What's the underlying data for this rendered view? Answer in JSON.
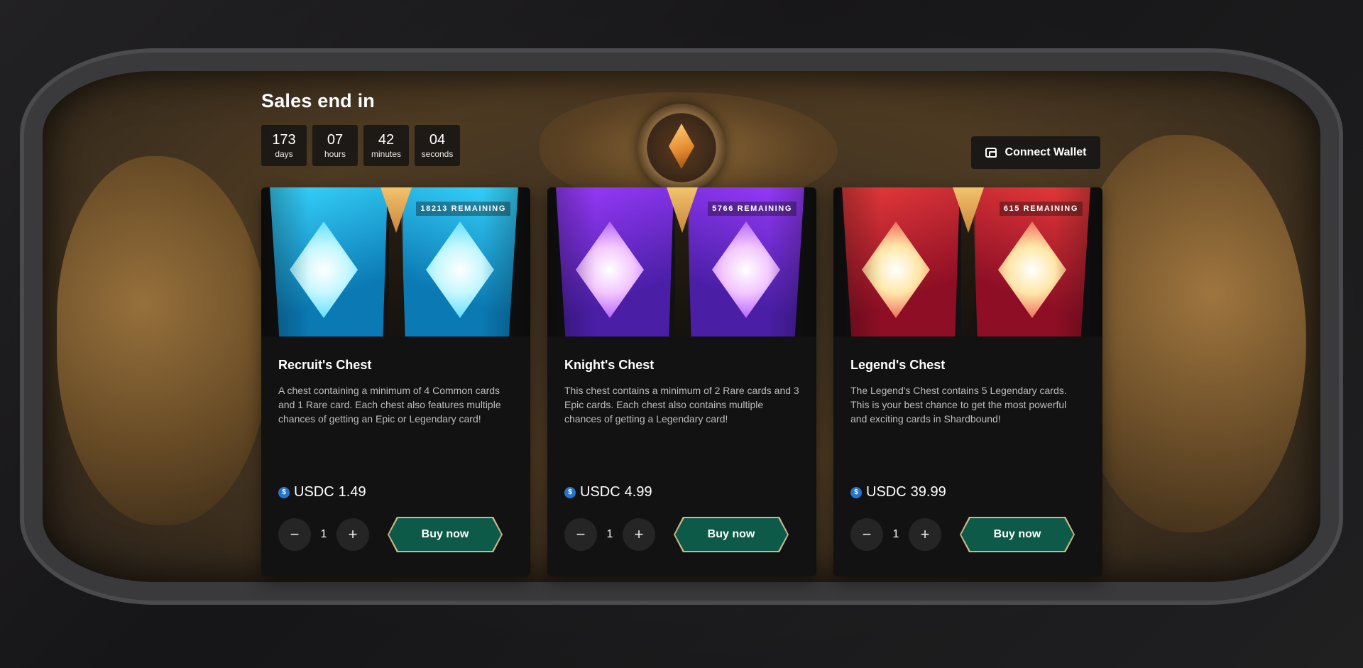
{
  "sale": {
    "title": "Sales end in",
    "countdown": [
      {
        "value": "173",
        "label": "days"
      },
      {
        "value": "07",
        "label": "hours"
      },
      {
        "value": "42",
        "label": "minutes"
      },
      {
        "value": "04",
        "label": "seconds"
      }
    ]
  },
  "header": {
    "connect_wallet_label": "Connect Wallet"
  },
  "cards": [
    {
      "remaining": "18213 REMAINING",
      "title": "Recruit's Chest",
      "description": "A chest containing a minimum of 4 Common cards and 1 Rare card. Each chest also features multiple chances of getting an Epic or Legendary card!",
      "currency": "USDC",
      "price": "1.49",
      "quantity": "1",
      "decrement_label": "−",
      "increment_label": "+",
      "buy_label": "Buy now",
      "theme": {
        "base": "#0b79b3",
        "light": "#38d6ff",
        "gem": "#c6f7ff"
      }
    },
    {
      "remaining": "5766 REMAINING",
      "title": "Knight's Chest",
      "description": "This chest contains a minimum of 2 Rare cards and 3 Epic cards. Each chest also contains multiple chances of getting a Legendary card!",
      "currency": "USDC",
      "price": "4.99",
      "quantity": "1",
      "decrement_label": "−",
      "increment_label": "+",
      "buy_label": "Buy now",
      "theme": {
        "base": "#4a1fa6",
        "light": "#9b3bff",
        "gem": "#f3c7ff"
      }
    },
    {
      "remaining": "615 REMAINING",
      "title": "Legend's Chest",
      "description": "The Legend's Chest contains 5 Legendary cards. This is your best chance to get the most powerful and exciting cards in Shardbound!",
      "currency": "USDC",
      "price": "39.99",
      "quantity": "1",
      "decrement_label": "−",
      "increment_label": "+",
      "buy_label": "Buy now",
      "theme": {
        "base": "#8e0f25",
        "light": "#e83b3b",
        "gem": "#ffe7a8"
      }
    }
  ],
  "icons": {
    "wallet": "wallet-icon",
    "usdc": "usdc-coin-icon",
    "usdc_glyph": "$"
  }
}
